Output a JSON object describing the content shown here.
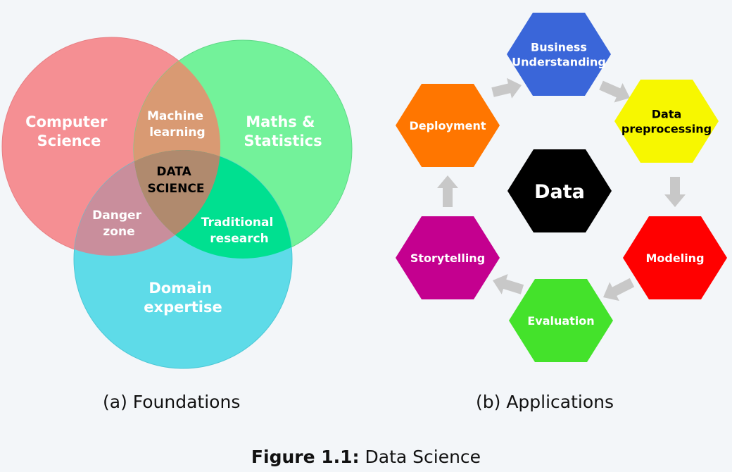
{
  "venn": {
    "regions": {
      "computer_science": [
        "Computer",
        "Science"
      ],
      "maths_statistics": [
        "Maths &",
        "Statistics"
      ],
      "domain_expertise": [
        "Domain",
        "expertise"
      ],
      "machine_learning": [
        "Machine",
        "learning"
      ],
      "danger_zone": [
        "Danger",
        "zone"
      ],
      "traditional_research": [
        "Traditional",
        "research"
      ],
      "data_science": [
        "DATA",
        "SCIENCE"
      ]
    },
    "colors": {
      "computer_science": "#f58f93",
      "maths_statistics": "#73f29a",
      "domain_expertise": "#5edbe8",
      "machine_learning": "#d99a73",
      "traditional_research": "#00e090",
      "danger_zone": "#c98e9c",
      "data_science": "#b08a6e"
    }
  },
  "cycle": {
    "center": {
      "label": "Data",
      "color": "#000000"
    },
    "steps": [
      {
        "label": [
          "Business",
          "Understanding"
        ],
        "color": "#3a66d9",
        "text_color": "#ffffff"
      },
      {
        "label": [
          "Data",
          "preprocessing"
        ],
        "color": "#f7f700",
        "text_color": "#000000"
      },
      {
        "label": [
          "Modeling"
        ],
        "color": "#ff0000",
        "text_color": "#ffffff"
      },
      {
        "label": [
          "Evaluation"
        ],
        "color": "#44e22b",
        "text_color": "#ffffff"
      },
      {
        "label": [
          "Storytelling"
        ],
        "color": "#c4008f",
        "text_color": "#ffffff"
      },
      {
        "label": [
          "Deployment"
        ],
        "color": "#ff7600",
        "text_color": "#ffffff"
      }
    ],
    "arrow_color": "#c8c8c8"
  },
  "captions": {
    "a": "(a) Foundations",
    "b": "(b) Applications",
    "figure_prefix": "Figure 1.1:",
    "figure_title": "Data Science"
  }
}
